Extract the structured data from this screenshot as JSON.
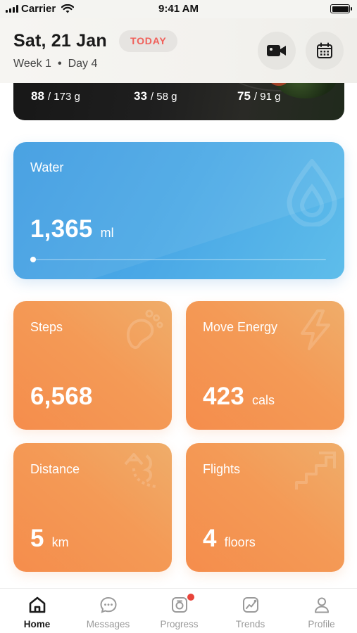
{
  "status_bar": {
    "carrier": "Carrier",
    "time": "9:41 AM"
  },
  "header": {
    "date": "Sat, 21 Jan",
    "today_badge": "TODAY",
    "week": "Week 1",
    "separator": "•",
    "day": "Day 4",
    "video_icon": "video-camera-icon",
    "calendar_icon": "calendar-icon"
  },
  "macros": [
    {
      "value": "88",
      "target": "/ 173 g"
    },
    {
      "value": "33",
      "target": "/ 58 g"
    },
    {
      "value": "75",
      "target": "/ 91 g"
    }
  ],
  "water": {
    "title": "Water",
    "value": "1,365",
    "unit": "ml",
    "progress": 0.0,
    "icon": "water-drop-icon",
    "color": "#4aa8e6"
  },
  "tiles": {
    "steps": {
      "title": "Steps",
      "value": "6,568",
      "unit": "",
      "icon": "footprint-icon"
    },
    "move_energy": {
      "title": "Move Energy",
      "value": "423",
      "unit": "cals",
      "icon": "lightning-icon"
    },
    "distance": {
      "title": "Distance",
      "value": "5",
      "unit": "km",
      "icon": "route-icon"
    },
    "flights": {
      "title": "Flights",
      "value": "4",
      "unit": "floors",
      "icon": "stairs-icon"
    },
    "color": "#f49a56"
  },
  "tab_bar": {
    "active": "home",
    "items": [
      {
        "label": "Home",
        "icon": "home-icon"
      },
      {
        "label": "Messages",
        "icon": "chat-bubble-icon"
      },
      {
        "label": "Progress",
        "icon": "camera-icon",
        "notification_dot": true
      },
      {
        "label": "Trends",
        "icon": "trend-chart-icon"
      },
      {
        "label": "Profile",
        "icon": "user-icon"
      }
    ]
  }
}
